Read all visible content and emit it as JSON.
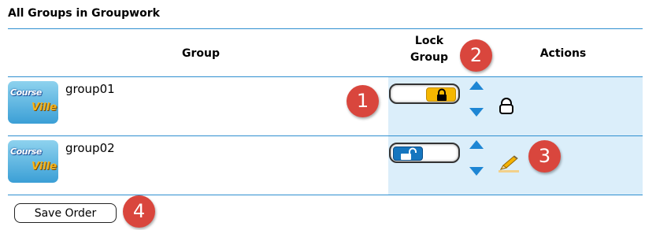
{
  "section_title": "All Groups in Groupwork",
  "columns": {
    "group": "Group",
    "lock_group_line1": "Lock",
    "lock_group_line2": "Group",
    "actions": "Actions"
  },
  "logo": {
    "line1": "Course",
    "line2": "Ville"
  },
  "rows": [
    {
      "name": "group01",
      "locked": true,
      "action_icon": "lock-icon"
    },
    {
      "name": "group02",
      "locked": false,
      "action_icon": "pencil-icon"
    }
  ],
  "save_button": "Save Order",
  "callouts": [
    "1",
    "2",
    "3",
    "4"
  ],
  "colors": {
    "accent": "#2f8fd0",
    "lock_column_bg": "#dbeefa",
    "locked_knob": "#f5b700",
    "unlocked_knob": "#1676bf",
    "callout_red": "#d9463d",
    "arrow_blue": "#1e86d4"
  }
}
